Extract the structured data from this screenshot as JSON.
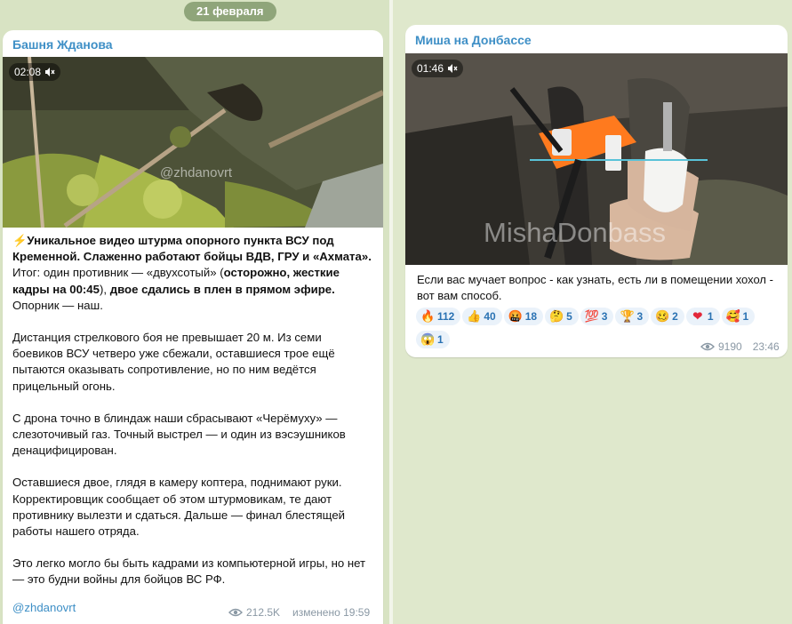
{
  "date_label": "21 февраля",
  "post_left": {
    "channel": "Башня Жданова",
    "video": {
      "duration": "02:08",
      "watermark": "@zhdanovrt"
    },
    "lead_bolt": "⚡",
    "lead_bold_1": "Уникальное видео штурма опорного пункта ВСУ под Кременной. Слаженно работают бойцы ВДВ, ГРУ и «Ахмата».",
    "line_itog_a": "Итог: один противник — «двухсотый» (",
    "line_itog_b": "осторожно, жесткие кадры на 00:45",
    "line_itog_c": "), ",
    "line_itog_d": "двое сдались в плен в прямом эфире.",
    "line_itog_e": "Опорник — наш.",
    "para2": "Дистанция стрелкового боя не превышает 20 м. Из семи боевиков ВСУ четверо уже сбежали, оставшиеся трое ещё пытаются оказывать сопротивление, но по ним ведётся прицельный огонь.",
    "para3": "С дрона точно в блиндаж наши сбрасывают «Черёмуху» — слезоточивый газ. Точный выстрел — и один из вэсэушников денацифицирован.",
    "para4": "Оставшиеся двое, глядя в камеру коптера, поднимают руки. Корректировщик сообщает об этом штурмовикам, те дают противнику вылезти и сдаться. Дальше — финал блестящей работы нашего отряда.",
    "para5": "Это легко могло бы быть кадрами из компьютерной игры, но нет — это будни войны для бойцов ВС РФ.",
    "link": "@zhdanovrt",
    "views": "212.5K",
    "edited": "изменено 19:59"
  },
  "post_right": {
    "channel": "Миша на Донбассе",
    "video": {
      "duration": "01:46",
      "watermark": "MishaDonbass"
    },
    "text": "Если вас мучает вопрос - как узнать, есть ли в помещении хохол - вот вам способ.",
    "reactions": [
      {
        "icon": "fire-emoji",
        "glyph": "🔥",
        "count": "112",
        "color": "#f26b1d"
      },
      {
        "icon": "thumbs-up-emoji",
        "glyph": "👍",
        "count": "40",
        "color": "#f3b431"
      },
      {
        "icon": "swearing-face-emoji",
        "glyph": "🤬",
        "count": "18",
        "color": "#d8382b"
      },
      {
        "icon": "thinking-face-emoji",
        "glyph": "🤔",
        "count": "5",
        "color": "#f3c13a"
      },
      {
        "icon": "hundred-emoji",
        "glyph": "💯",
        "count": "3",
        "color": "#e0344b"
      },
      {
        "icon": "trophy-emoji",
        "glyph": "🏆",
        "count": "3",
        "color": "#e9a91e"
      },
      {
        "icon": "woozy-face-emoji",
        "glyph": "🥴",
        "count": "2",
        "color": "#f3c13a"
      },
      {
        "icon": "heart-emoji",
        "glyph": "❤",
        "count": "1",
        "color": "#e2283a"
      },
      {
        "icon": "hearts-face-emoji",
        "glyph": "🥰",
        "count": "1",
        "color": "#f3c13a"
      },
      {
        "icon": "screaming-face-emoji",
        "glyph": "😱",
        "count": "1",
        "color": "#7fb0e0"
      }
    ],
    "views": "9190",
    "time": "23:46"
  }
}
